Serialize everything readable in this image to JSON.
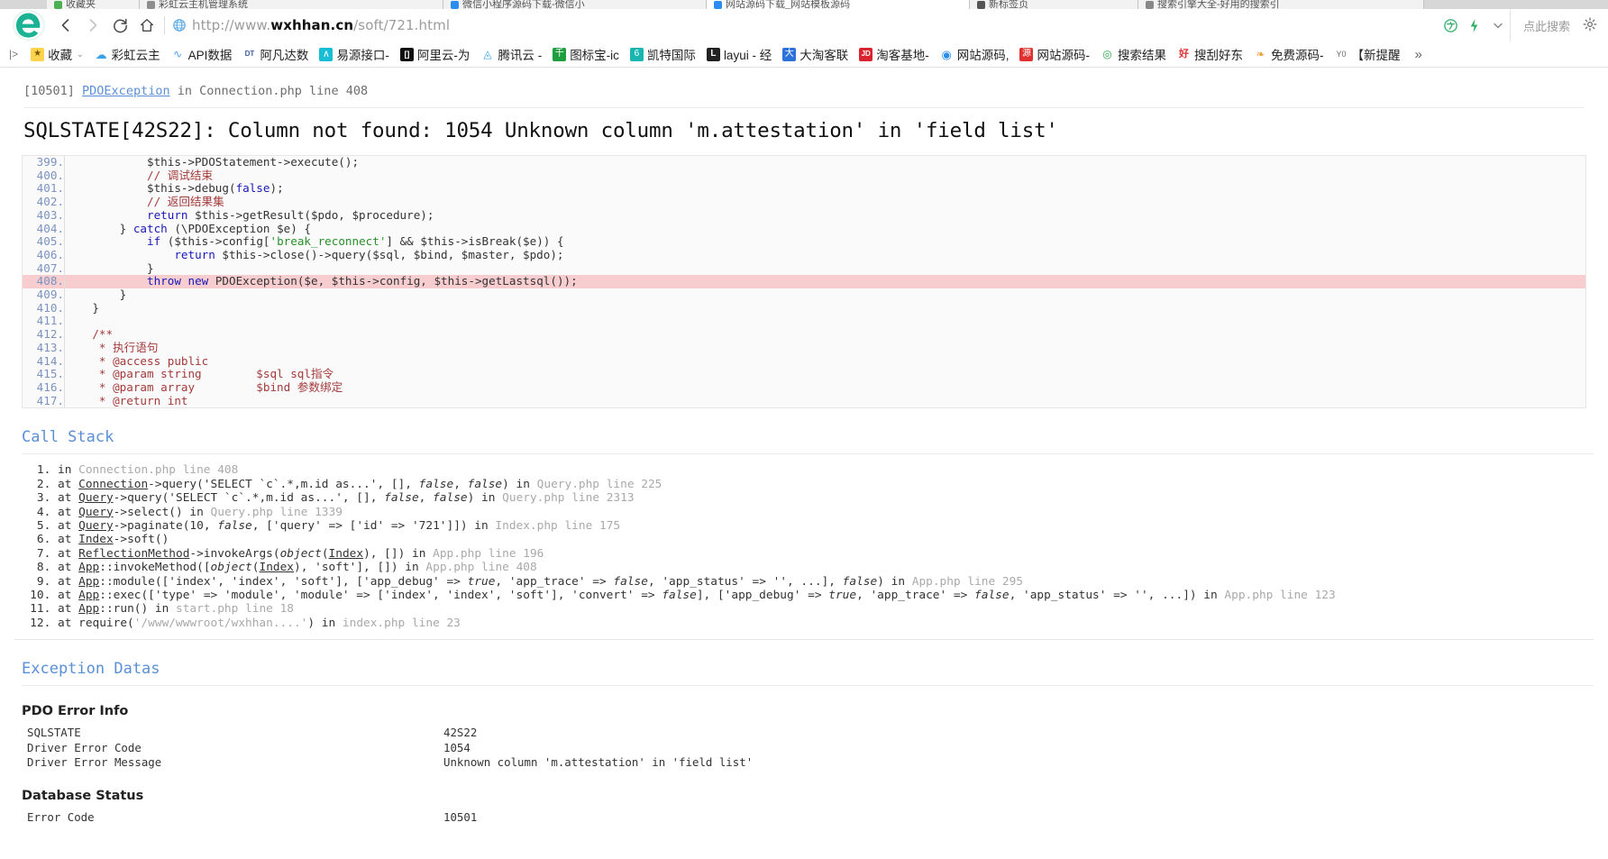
{
  "browser": {
    "tabs": [
      {
        "label": "收藏夹",
        "color": "#4caf50",
        "active": false
      },
      {
        "label": "彩虹云主机管理系统",
        "color": "#8e8e8e",
        "active": false
      },
      {
        "label": "微信小程序源码下载-微信小",
        "color": "#2d8cf0",
        "active": false
      },
      {
        "label": "网站源码下载_网站模板源码",
        "color": "#2d8cf0",
        "active": true
      },
      {
        "label": "新标签页",
        "color": "#555555",
        "active": false
      },
      {
        "label": "搜索引擎大全-好用的搜索引",
        "color": "#888888",
        "active": false
      }
    ],
    "nav": {
      "back_icon": "back-arrow-icon",
      "forward_icon": "forward-arrow-icon",
      "reload_icon": "reload-icon",
      "home_icon": "home-icon",
      "url_icon": "globe-icon",
      "url_prefix": "http://www.",
      "url_domain": "wxhhan.cn",
      "url_path": "/soft/721.html",
      "search_placeholder": "点此搜索"
    },
    "bookmarks": [
      {
        "label": "收藏",
        "icon": "star-icon",
        "bg": "#f7c948",
        "glyph": "★",
        "caret": true
      },
      {
        "label": "彩虹云主",
        "icon": "cloud-icon",
        "bg": "#ffffff",
        "glyph": "☁",
        "fg": "#3aa0e8"
      },
      {
        "label": "API数据",
        "icon": "chart-icon",
        "bg": "#ffffff",
        "glyph": "📈",
        "fg": "#4aa3ff"
      },
      {
        "label": "阿凡达数",
        "icon": "dt-icon",
        "bg": "#ffffff",
        "glyph": "DT",
        "fg": "#4060a0"
      },
      {
        "label": "易源接口-",
        "icon": "mountain-icon",
        "bg": "#1fb3c7",
        "glyph": "∧"
      },
      {
        "label": "阿里云-为",
        "icon": "bracket-icon",
        "bg": "#111111",
        "glyph": "C]"
      },
      {
        "label": "腾讯云 -",
        "icon": "tencent-cloud-icon",
        "bg": "#ffffff",
        "glyph": "◬",
        "fg": "#3aa0e8"
      },
      {
        "label": "图标宝-ic",
        "icon": "green-square-icon",
        "bg": "#1e9e3e",
        "glyph": "千"
      },
      {
        "label": "凯特国际",
        "icon": "teal-square-icon",
        "bg": "#19b5b0",
        "glyph": "6"
      },
      {
        "label": "layui - 经",
        "icon": "layui-icon",
        "bg": "#222222",
        "glyph": "L"
      },
      {
        "label": "大淘客联",
        "icon": "blue-square-icon",
        "bg": "#2d72d9",
        "glyph": "大"
      },
      {
        "label": "淘客基地-",
        "icon": "jd-icon",
        "bg": "#d9232e",
        "glyph": "JD"
      },
      {
        "label": "网站源码,",
        "icon": "chrome-icon",
        "bg": "#ffffff",
        "glyph": "◉",
        "fg": "#2d8cf0"
      },
      {
        "label": "网站源码-",
        "icon": "yuan-icon",
        "bg": "#e03131",
        "glyph": "源"
      },
      {
        "label": "搜索结果",
        "icon": "target-icon",
        "bg": "#ffffff",
        "glyph": "◎",
        "fg": "#2fa84f"
      },
      {
        "label": "搜刮好东",
        "icon": "hao-icon",
        "bg": "#ffffff",
        "glyph": "好",
        "fg": "#e03131"
      },
      {
        "label": "免费源码-",
        "icon": "person-icon",
        "bg": "#ffffff",
        "glyph": "🏃",
        "fg": "#e8a33d"
      },
      {
        "label": "【新提醒",
        "icon": "yo-icon",
        "bg": "#ffffff",
        "glyph": "Y0",
        "fg": "#666666"
      }
    ],
    "bookmarks_overflow": "»",
    "bookmark_toggle": "|>"
  },
  "exception": {
    "code": "[10501]",
    "class": "PDOException",
    "in_text": "in",
    "location": "Connection.php line 408",
    "message": "SQLSTATE[42S22]: Column not found: 1054 Unknown column 'm.attestation' in 'field list'"
  },
  "code_block": {
    "highlight_line": 408,
    "lines": [
      {
        "no": "399.",
        "text": "            $this->PDOStatement->execute();"
      },
      {
        "no": "400.",
        "text": "            // 调试结束"
      },
      {
        "no": "401.",
        "text": "            $this->debug(false);"
      },
      {
        "no": "402.",
        "text": "            // 返回结果集"
      },
      {
        "no": "403.",
        "text": "            return $this->getResult($pdo, $procedure);"
      },
      {
        "no": "404.",
        "text": "        } catch (\\PDOException $e) {"
      },
      {
        "no": "405.",
        "text": "            if ($this->config['break_reconnect'] && $this->isBreak($e)) {"
      },
      {
        "no": "406.",
        "text": "                return $this->close()->query($sql, $bind, $master, $pdo);"
      },
      {
        "no": "407.",
        "text": "            }"
      },
      {
        "no": "408.",
        "text": "            throw new PDOException($e, $this->config, $this->getLastsql());"
      },
      {
        "no": "409.",
        "text": "        }"
      },
      {
        "no": "410.",
        "text": "    }"
      },
      {
        "no": "411.",
        "text": ""
      },
      {
        "no": "412.",
        "text": "    /**"
      },
      {
        "no": "413.",
        "text": "     * 执行语句"
      },
      {
        "no": "414.",
        "text": "     * @access public"
      },
      {
        "no": "415.",
        "text": "     * @param string        $sql sql指令"
      },
      {
        "no": "416.",
        "text": "     * @param array         $bind 参数绑定"
      },
      {
        "no": "417.",
        "text": "     * @return int"
      }
    ]
  },
  "call_stack": {
    "title": "Call Stack",
    "items": [
      "in Connection.php line 408",
      "at Connection->query('SELECT `c`.*,m.id as...', [], false, false) in Query.php line 225",
      "at Query->query('SELECT `c`.*,m.id as...', [], false, false) in Query.php line 2313",
      "at Query->select() in Query.php line 1339",
      "at Query->paginate(10, false, ['query' => ['id' => '721']]) in Index.php line 175",
      "at Index->soft()",
      "at ReflectionMethod->invokeArgs(object(Index), []) in App.php line 196",
      "at App::invokeMethod([object(Index), 'soft'], []) in App.php line 408",
      "at App::module(['index', 'index', 'soft'], ['app_debug' => true, 'app_trace' => false, 'app_status' => '', ...], false) in App.php line 295",
      "at App::exec(['type' => 'module', 'module' => ['index', 'index', 'soft'], 'convert' => false], ['app_debug' => true, 'app_trace' => false, 'app_status' => '', ...]) in App.php line 123",
      "at App::run() in start.php line 18",
      "at require('/www/wwwroot/wxhhan....') in index.php line 23"
    ]
  },
  "exception_datas": {
    "title": "Exception Datas",
    "groups": [
      {
        "heading": "PDO Error Info",
        "rows": [
          {
            "key": "SQLSTATE",
            "value": "42S22"
          },
          {
            "key": "Driver Error Code",
            "value": "1054"
          },
          {
            "key": "Driver Error Message",
            "value": "Unknown column 'm.attestation' in 'field list'"
          }
        ]
      },
      {
        "heading": "Database Status",
        "rows": [
          {
            "key": "Error Code",
            "value": "10501"
          }
        ]
      }
    ]
  }
}
